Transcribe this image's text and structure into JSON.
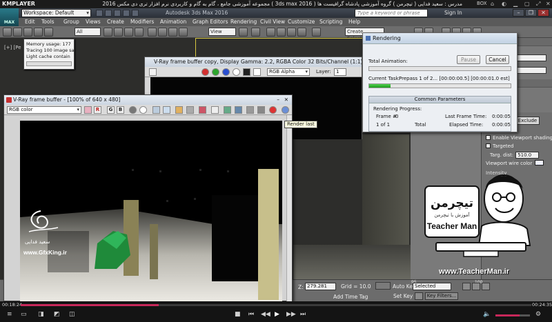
{
  "player": {
    "logo": "KMPLAYER",
    "title": "مجموعه آموزشی جامع ، گام به گام و کاربردی نرم افزار تری دی مکس 2016 ( 3ds max 2016 )  مدرس : سعید فدایی ( تیچرمن ) گروه آموزشی پادشاه گرافیست ها",
    "box_label": "BOX",
    "time_elapsed": "00:18:24",
    "time_total": "00:24:35",
    "progress": 0.27
  },
  "max": {
    "logo": "MAX",
    "workspace": "Workspace: Default",
    "title": "Autodesk 3ds Max 2016",
    "search_placeholder": "Type a keyword or phrase",
    "sign_in": "Sign In",
    "menus": [
      "Edit",
      "Tools",
      "Group",
      "Views",
      "Create",
      "Modifiers",
      "Animation",
      "Graph Editors",
      "Rendering",
      "Civil View",
      "Customize",
      "Scripting",
      "Help"
    ],
    "toolbar": {
      "filter_value": "All",
      "view_value": "View",
      "selection_set_placeholder": "Create Selection Se"
    },
    "viewport_label": "[+] [Pe"
  },
  "mem_popup": {
    "lines": [
      "Memory usage: 177",
      "Tracing 100 image sa",
      "Light cache contain"
    ]
  },
  "rendering": {
    "title": "Rendering",
    "pause": "Pause",
    "cancel": "Cancel",
    "total_animation_label": "Total Animation:",
    "total_progress": 0,
    "current_task_label": "Current Task:",
    "current_task_value": "Prepass 1 of 2... [00:00:00.5] [00:00:01.0 est]",
    "current_progress": 0.15,
    "section_title": "Common Parameters",
    "progress_header": "Rendering Progress:",
    "frame_label": "Frame #",
    "frame_value": "0",
    "of_value": "1 of 1",
    "total_label": "Total",
    "last_frame_label": "Last Frame Time:",
    "last_frame_value": "0:00:05",
    "elapsed_label": "Elapsed Time:",
    "elapsed_value": "0:00:05"
  },
  "vfb_copy": {
    "title": "V-Ray frame buffer copy, Display Gamma: 2.2, RGBA Color 32 Bits/Channel (1:1)",
    "channel": "RGB Alpha",
    "layer_label": "Layer:",
    "layer_value": "1"
  },
  "vfb": {
    "title": "V-Ray frame buffer - [100% of 640 x 480]",
    "channel": "RGB color",
    "buttons": [
      "R",
      "G",
      "B"
    ]
  },
  "tooltip": "Render last",
  "light_props": {
    "exclude": "Exclude",
    "enable_viewport_shading": "Enable Viewport shading",
    "targeted": "Targeted",
    "targ_dist_label": "Targ. dist:",
    "targ_dist_value": "510.0",
    "viewport_wire_color": "Viewport wire color",
    "intensity": "Intensity"
  },
  "status": {
    "coord_value": "279.281",
    "grid": "Grid = 10.0",
    "add_time_tag": "Add Time Tag",
    "auto_key": "Auto Key",
    "selected": "Selected",
    "set_key": "Set Key",
    "key_filters": "Key Filters...",
    "frame_marks": [
      "95",
      "100"
    ]
  },
  "watermarks": {
    "teacherman_brand": "تیچرمن",
    "teacherman_sub": "آموزش با تیچرمن",
    "teacherman_name": "Teacher Man",
    "teacherman_url": "www.TeacherMan.ir",
    "gfx_name": "سعید فدایی",
    "gfx_url": "www.GfxKing.ir"
  },
  "colors": {
    "accent": "#c8285a",
    "progress_green": "#1d9a1d",
    "frame_yellow": "#d8c840"
  }
}
